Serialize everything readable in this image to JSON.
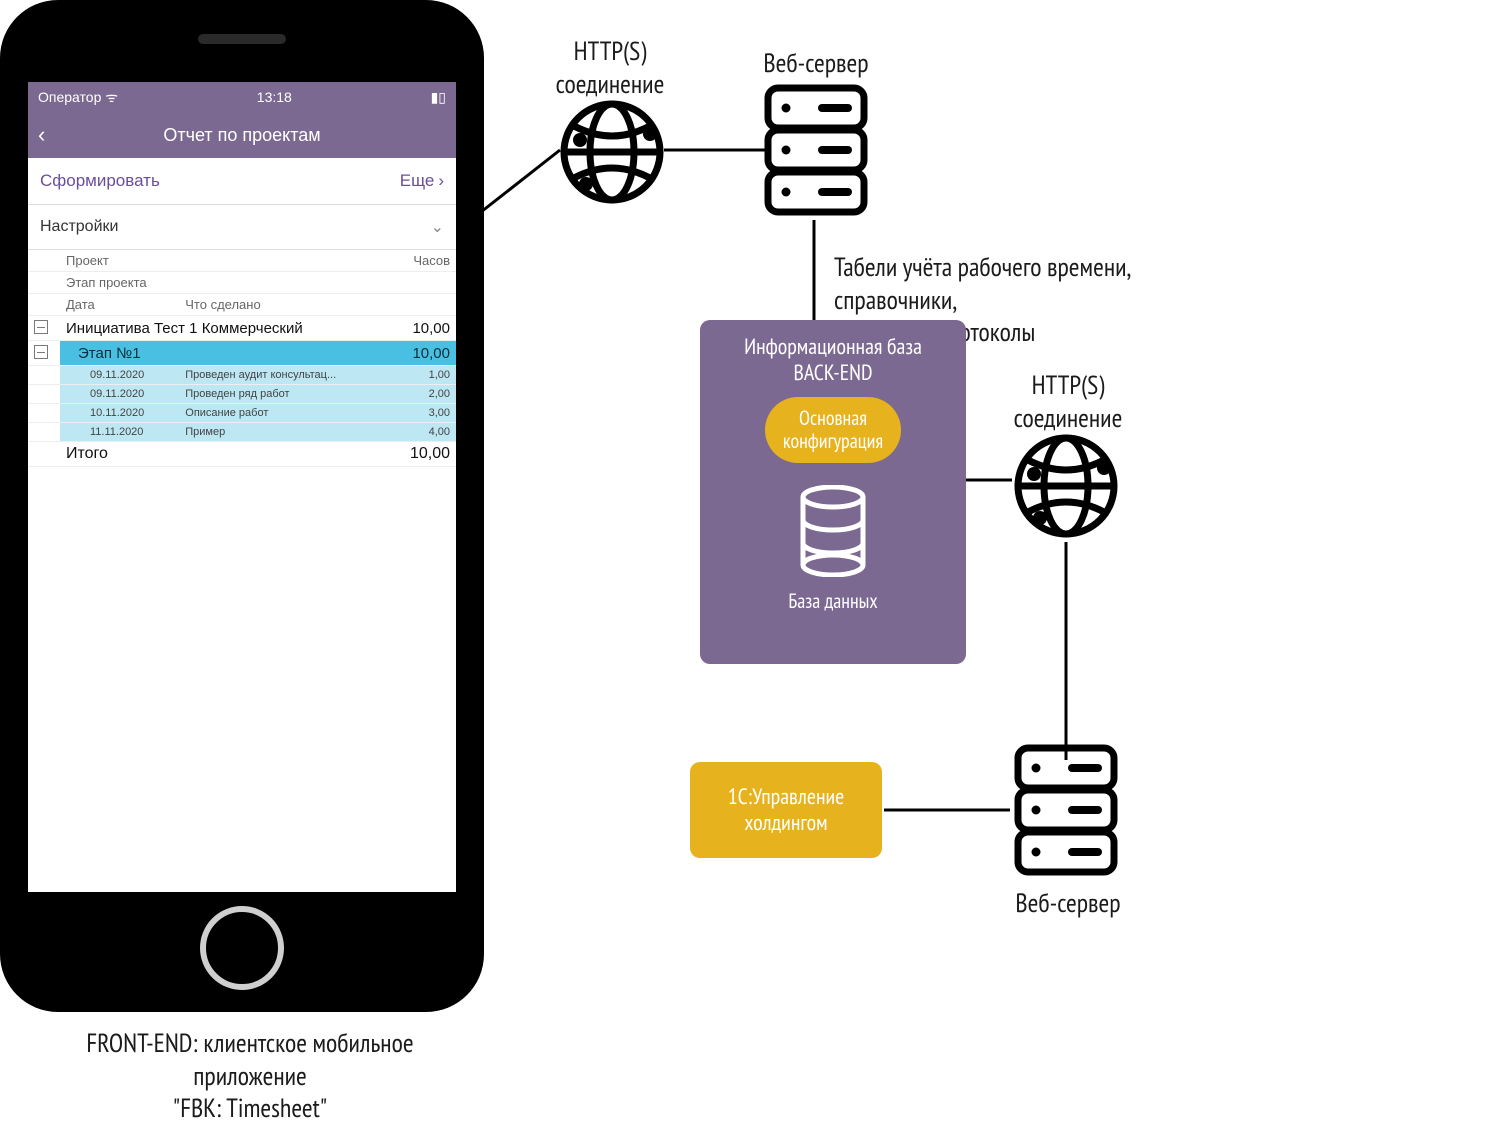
{
  "phone": {
    "statusbar": {
      "carrier": "Оператор",
      "time": "13:18"
    },
    "navbar": {
      "title": "Отчет по проектам"
    },
    "toolbar": {
      "generate": "Сформировать",
      "more": "Еще"
    },
    "settings_row": "Настройки",
    "headers": {
      "project": "Проект",
      "hours": "Часов",
      "stage": "Этап проекта",
      "date": "Дата",
      "done": "Что сделано"
    },
    "rows": {
      "project": {
        "name": "Инициатива Тест 1 Коммерческий",
        "hours": "10,00"
      },
      "stage": {
        "name": "Этап №1",
        "hours": "10,00"
      },
      "entries": [
        {
          "date": "09.11.2020",
          "what": "Проведен аудит консультац...",
          "hours": "1,00"
        },
        {
          "date": "09.11.2020",
          "what": "Проведен ряд работ",
          "hours": "2,00"
        },
        {
          "date": "10.11.2020",
          "what": "Описание работ",
          "hours": "3,00"
        },
        {
          "date": "11.11.2020",
          "what": "Пример",
          "hours": "4,00"
        }
      ],
      "total": {
        "label": "Итого",
        "hours": "10,00"
      }
    }
  },
  "labels": {
    "http_top": "HTTP(S)\nсоединение",
    "webserver_top": "Веб-сервер",
    "data_flow": "Табели учёта рабочего времени, справочники,\nнастройки, протоколы",
    "backend_title": "Информационная база\nBACK-END",
    "backend_chip": "Основная\nконфигурация",
    "backend_db": "База данных",
    "http_right": "HTTP(S)\nсоединение",
    "holding": "1С:Управление\nхолдингом",
    "webserver_bottom": "Веб-сервер",
    "frontend_caption": "FRONT-END: клиентское мобильное приложение\n\"FBK: Timesheet\""
  },
  "colors": {
    "purple": "#7c6991",
    "gold": "#e6b21e",
    "cyan": "#49c0e2",
    "cyan_light": "#bce7f3"
  }
}
